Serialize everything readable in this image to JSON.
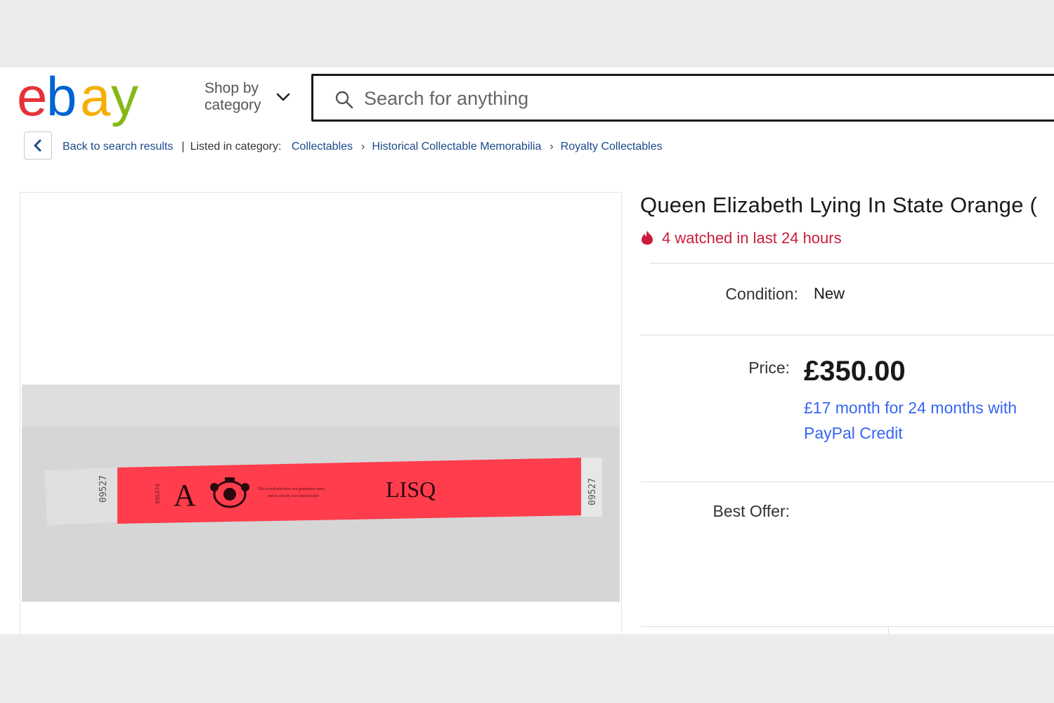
{
  "header": {
    "logo": {
      "text": "ebay",
      "colors": [
        "#e53238",
        "#0064d2",
        "#f5af02",
        "#86b817"
      ]
    },
    "shop_by": "Shop by category",
    "search": {
      "placeholder": "Search for anything",
      "value": ""
    }
  },
  "breadcrumb": {
    "back": "Back to search results",
    "listed_in": "Listed in category:",
    "items": [
      "Collectables",
      "Historical Collectable Memorabilia",
      "Royalty Collectables"
    ]
  },
  "listing": {
    "title": "Queen Elizabeth Lying In State Orange (",
    "watched": "4 watched in last 24 hours",
    "condition_label": "Condition:",
    "condition_value": "New",
    "price_label": "Price:",
    "price": "£350.00",
    "credit_line1": "£17 month for 24 months with",
    "credit_line2": "PayPal Credit",
    "best_offer_label": "Best Offer:"
  },
  "photo": {
    "wristband": {
      "letter": "A",
      "code": "LISQ",
      "serial": "09527",
      "side_number": "095474",
      "fine_print_1": "This wristband does not guarantee entry",
      "fine_print_2": "and is strictly non-transferable"
    },
    "colors": {
      "band": "#ff3d4d",
      "stub": "#dcdcdc",
      "background": "#d6d6d6"
    }
  },
  "colors": {
    "link": "#1b4a8a",
    "credit": "#3665f3",
    "watch": "#c81e3c",
    "title": "#191919"
  }
}
